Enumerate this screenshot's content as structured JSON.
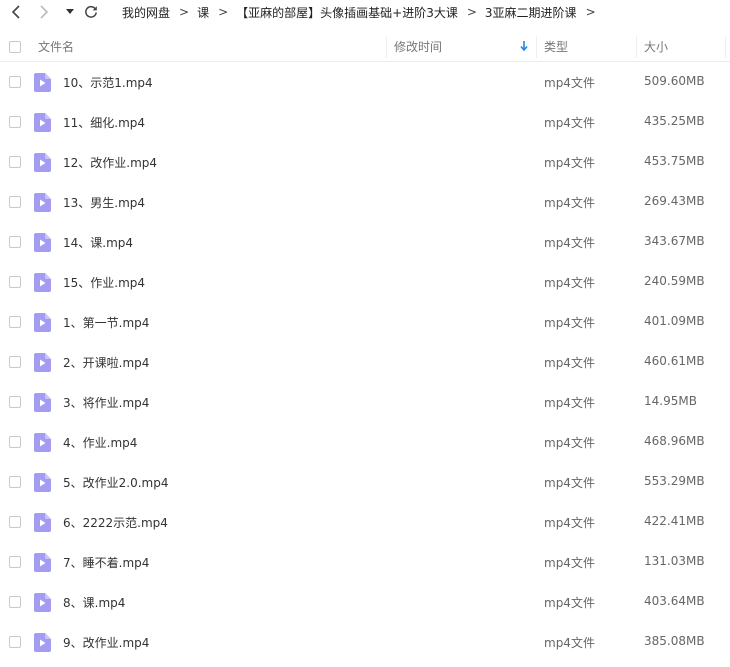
{
  "nav": {
    "back_icon": "chevron-left-icon",
    "forward_icon": "chevron-right-icon",
    "dropdown_icon": "caret-down-icon",
    "refresh_icon": "refresh-icon"
  },
  "breadcrumb": [
    "我的网盘",
    "课",
    "【亚麻的部屋】头像插画基础+进阶3大课",
    "3亚麻二期进阶课"
  ],
  "breadcrumb_separator": ">",
  "header": {
    "name": "文件名",
    "modified": "修改时间",
    "type": "类型",
    "size": "大小",
    "sort_icon": "sort-down-arrow-icon"
  },
  "colors": {
    "file_icon": "#a39cf2",
    "file_icon_fold": "#c9c3fa",
    "sort_arrow": "#1e88e5"
  },
  "files": [
    {
      "name": "10、示范1.mp4",
      "type": "mp4文件",
      "size": "509.60MB"
    },
    {
      "name": "11、细化.mp4",
      "type": "mp4文件",
      "size": "435.25MB"
    },
    {
      "name": "12、改作业.mp4",
      "type": "mp4文件",
      "size": "453.75MB"
    },
    {
      "name": "13、男生.mp4",
      "type": "mp4文件",
      "size": "269.43MB"
    },
    {
      "name": "14、课.mp4",
      "type": "mp4文件",
      "size": "343.67MB"
    },
    {
      "name": "15、作业.mp4",
      "type": "mp4文件",
      "size": "240.59MB"
    },
    {
      "name": "1、第一节.mp4",
      "type": "mp4文件",
      "size": "401.09MB"
    },
    {
      "name": "2、开课啦.mp4",
      "type": "mp4文件",
      "size": "460.61MB"
    },
    {
      "name": "3、将作业.mp4",
      "type": "mp4文件",
      "size": "14.95MB"
    },
    {
      "name": "4、作业.mp4",
      "type": "mp4文件",
      "size": "468.96MB"
    },
    {
      "name": "5、改作业2.0.mp4",
      "type": "mp4文件",
      "size": "553.29MB"
    },
    {
      "name": "6、2222示范.mp4",
      "type": "mp4文件",
      "size": "422.41MB"
    },
    {
      "name": "7、睡不着.mp4",
      "type": "mp4文件",
      "size": "131.03MB"
    },
    {
      "name": "8、课.mp4",
      "type": "mp4文件",
      "size": "403.64MB"
    },
    {
      "name": "9、改作业.mp4",
      "type": "mp4文件",
      "size": "385.08MB"
    }
  ]
}
